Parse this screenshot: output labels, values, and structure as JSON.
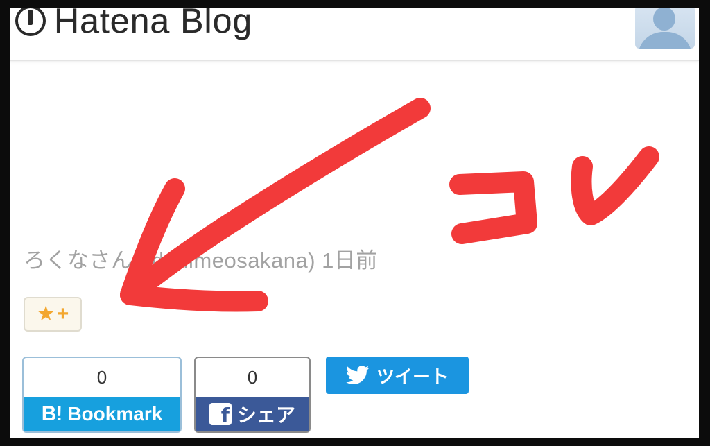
{
  "header": {
    "logo_text": "Hatena Blog",
    "logo_icon": "hatena-pen-icon",
    "avatar_icon": "user-avatar-icon"
  },
  "entry": {
    "author_line": "ろくなさん (idohimeosakana) 1日前"
  },
  "star_button": {
    "star_icon": "star-icon",
    "plus_label": "+"
  },
  "share": {
    "bookmark": {
      "count": "0",
      "icon_label": "B!",
      "label": "Bookmark",
      "color": "#17a0de"
    },
    "facebook": {
      "count": "0",
      "icon_label": "f",
      "label": "シェア",
      "color": "#3b5998"
    },
    "twitter": {
      "label": "ツイート",
      "icon": "twitter-bird-icon",
      "color": "#1b95e0"
    }
  },
  "annotation": {
    "text": "コレ",
    "color": "#f23a3a"
  }
}
